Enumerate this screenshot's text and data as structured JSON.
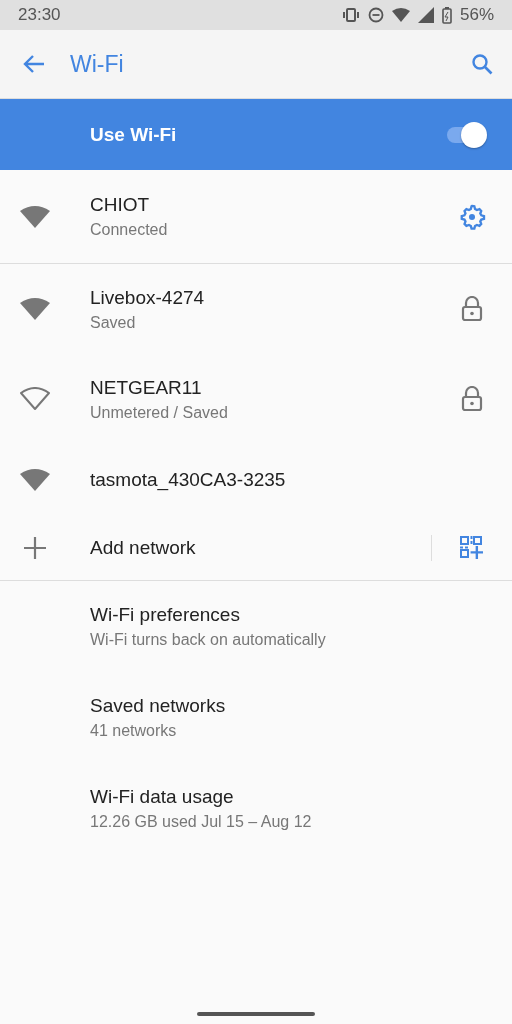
{
  "status_bar": {
    "time": "23:30",
    "battery": "56%"
  },
  "app_bar": {
    "title": "Wi-Fi"
  },
  "master_switch": {
    "label": "Use Wi-Fi",
    "on": true
  },
  "connected": [
    {
      "name": "CHIOT",
      "status": "Connected",
      "signal": {
        "kind": "filled"
      },
      "action": {
        "kind": "settings"
      }
    }
  ],
  "networks": [
    {
      "name": "Livebox-4274",
      "status": "Saved",
      "signal": {
        "kind": "filled"
      },
      "action": {
        "kind": "lock"
      }
    },
    {
      "name": "NETGEAR11",
      "status": "Unmetered / Saved",
      "signal": {
        "kind": "outline"
      },
      "action": {
        "kind": "lock"
      }
    },
    {
      "name": "tasmota_430CA3-3235",
      "signal": {
        "kind": "filled"
      }
    }
  ],
  "add_network": {
    "label": "Add network"
  },
  "preferences": [
    {
      "title": "Wi-Fi preferences",
      "summary": "Wi-Fi turns back on automatically"
    },
    {
      "title": "Saved networks",
      "summary": "41 networks"
    },
    {
      "title": "Wi-Fi data usage",
      "summary": "12.26 GB used Jul 15 – Aug 12"
    }
  ]
}
